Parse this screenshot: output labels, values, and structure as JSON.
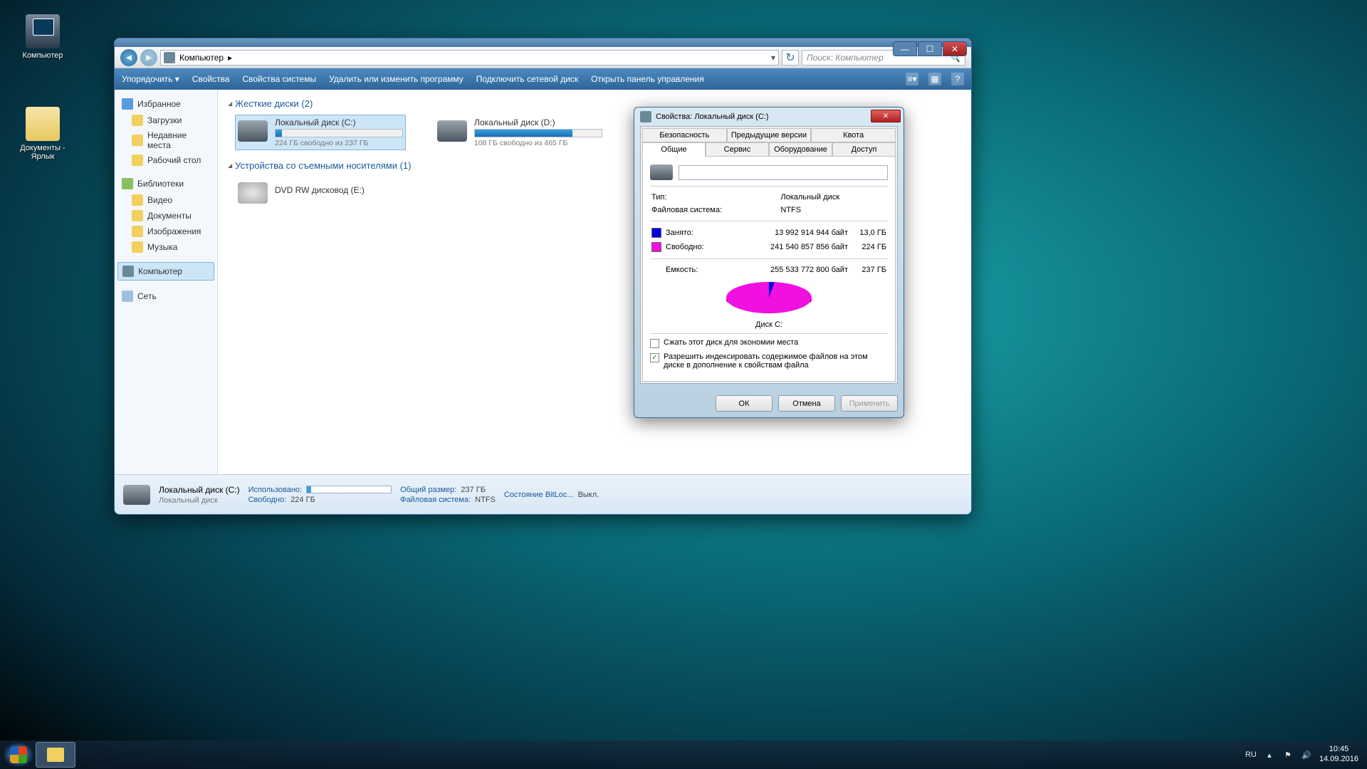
{
  "desktop": {
    "icons": [
      {
        "label": "Компьютер"
      },
      {
        "label": "Документы - Ярлык"
      }
    ]
  },
  "explorer": {
    "address": {
      "location": "Компьютер",
      "arrow": "▸"
    },
    "search_placeholder": "Поиск: Компьютер",
    "toolbar": {
      "organize": "Упорядочить ▾",
      "properties": "Свойства",
      "system_properties": "Свойства системы",
      "uninstall": "Удалить или изменить программу",
      "map_drive": "Подключить сетевой диск",
      "control_panel": "Открыть панель управления"
    },
    "sidebar": {
      "favorites": "Избранное",
      "downloads": "Загрузки",
      "recent": "Недавние места",
      "desktop": "Рабочий стол",
      "libraries": "Библиотеки",
      "videos": "Видео",
      "documents": "Документы",
      "pictures": "Изображения",
      "music": "Музыка",
      "computer": "Компьютер",
      "network": "Сеть"
    },
    "groups": {
      "hdd": "Жесткие диски (2)",
      "removable": "Устройства со съемными носителями (1)"
    },
    "drives": {
      "c": {
        "name": "Локальный диск (C:)",
        "free": "224 ГБ свободно из 237 ГБ",
        "pct": 5
      },
      "d": {
        "name": "Локальный диск (D:)",
        "free": "108 ГБ свободно из 465 ГБ",
        "pct": 77
      },
      "e": {
        "name": "DVD RW дисковод (E:)"
      }
    },
    "details": {
      "title": "Локальный диск (C:)",
      "type": "Локальный диск",
      "used_lbl": "Использовано:",
      "used_pct": 5,
      "free_lbl": "Свободно:",
      "free_val": "224 ГБ",
      "size_lbl": "Общий размер:",
      "size_val": "237 ГБ",
      "fs_lbl": "Файловая система:",
      "fs_val": "NTFS",
      "bitlocker_lbl": "Состояние BitLoc...",
      "bitlocker_val": "Выкл."
    }
  },
  "props": {
    "title": "Свойства: Локальный диск (C:)",
    "tabs": {
      "security": "Безопасность",
      "prev_versions": "Предыдущие версии",
      "quota": "Квота",
      "general": "Общие",
      "tools": "Сервис",
      "hardware": "Оборудование",
      "sharing": "Доступ"
    },
    "type_lbl": "Тип:",
    "type_val": "Локальный диск",
    "fs_lbl": "Файловая система:",
    "fs_val": "NTFS",
    "used_lbl": "Занято:",
    "used_bytes": "13 992 914 944 байт",
    "used_gb": "13,0 ГБ",
    "free_lbl": "Свободно:",
    "free_bytes": "241 540 857 856 байт",
    "free_gb": "224 ГБ",
    "capacity_lbl": "Емкость:",
    "capacity_bytes": "255 533 772 800 байт",
    "capacity_gb": "237 ГБ",
    "pie_label": "Диск C:",
    "compress_chk": "Сжать этот диск для экономии места",
    "index_chk": "Разрешить индексировать содержимое файлов на этом диске в дополнение к свойствам файла",
    "btn_ok": "ОК",
    "btn_cancel": "Отмена",
    "btn_apply": "Применить"
  },
  "taskbar": {
    "lang": "RU",
    "time": "10:45",
    "date": "14.09.2016"
  },
  "chart_data": {
    "type": "pie",
    "title": "Диск C:",
    "series": [
      {
        "name": "Занято",
        "value": 13.0,
        "unit": "ГБ",
        "bytes": 13992914944,
        "color": "#0000e0"
      },
      {
        "name": "Свободно",
        "value": 224,
        "unit": "ГБ",
        "bytes": 241540857856,
        "color": "#f010e0"
      }
    ],
    "total": {
      "name": "Емкость",
      "value": 237,
      "unit": "ГБ",
      "bytes": 255533772800
    }
  }
}
